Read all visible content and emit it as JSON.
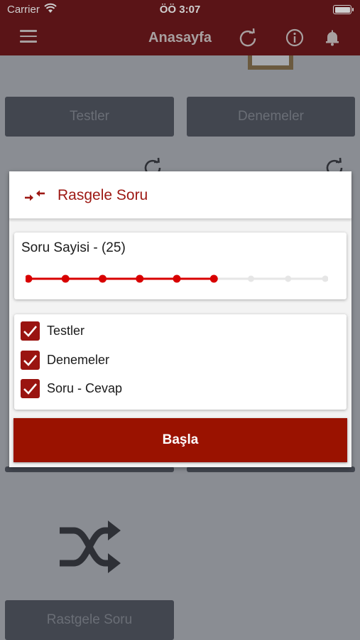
{
  "status_bar": {
    "carrier": "Carrier",
    "time": "ÖÖ 3:07",
    "wifi_icon": "wifi-icon",
    "battery_icon": "battery-icon"
  },
  "nav_bar": {
    "title": "Anasayfa",
    "icons": [
      "menu-icon",
      "refresh-icon",
      "info-icon",
      "bell-icon"
    ]
  },
  "background": {
    "tiles": [
      {
        "label": "Testler"
      },
      {
        "label": "Denemeler"
      },
      {
        "label": "Rastgele Soru"
      }
    ]
  },
  "modal": {
    "title": "Rasgele Soru",
    "title_icon": "compress-arrows-icon",
    "count_title": "Soru Sayisi - (25)",
    "slider": {
      "steps": 9,
      "selected_step": 6
    },
    "checkboxes": [
      {
        "label": "Testler",
        "checked": true
      },
      {
        "label": "Denemeler",
        "checked": true
      },
      {
        "label": "Soru - Cevap",
        "checked": true
      }
    ],
    "start_label": "Başla"
  },
  "colors": {
    "header": "#5a1417",
    "accent": "#9d1813",
    "button": "#9a1200",
    "slider_active": "#d80000",
    "slider_inactive": "#e6e6e6"
  }
}
